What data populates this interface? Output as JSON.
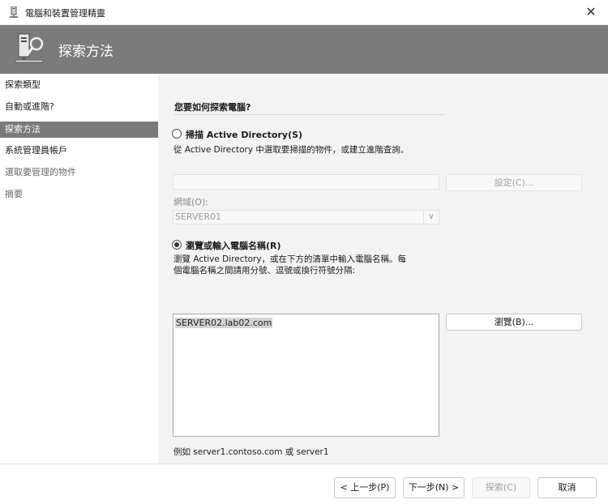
{
  "window": {
    "title": "電腦和裝置管理精靈",
    "close_glyph": "✕"
  },
  "banner": {
    "heading": "探索方法"
  },
  "sidebar": {
    "items": [
      {
        "label": "探索類型"
      },
      {
        "label": "自動或進階?"
      },
      {
        "label": "探索方法"
      },
      {
        "label": "系統管理員帳戶"
      },
      {
        "label": "選取要管理的物件"
      },
      {
        "label": "摘要"
      }
    ]
  },
  "main": {
    "question": "您要如何探索電腦?",
    "option_scan": {
      "label": "掃描 Active Directory(S)",
      "selected": false,
      "description": "從 Active Directory 中選取要掃描的物件，或建立進階查詢。"
    },
    "settings_button": "設定(C)...",
    "domain_label": "網域(O):",
    "domain_value": "SERVER01",
    "option_browse": {
      "label": "瀏覽或輸入電腦名稱(R)",
      "selected": true,
      "description_line1": "瀏覽 Active Directory，或在下方的清單中輸入電腦名稱。每",
      "description_line2": "個電腦名稱之間請用分號、逗號或換行符號分隔:"
    },
    "computer_names": "SERVER02.lab02.com",
    "browse_button": "瀏覽(B)...",
    "example": "例如 server1.contoso.com 或 server1"
  },
  "footer": {
    "back": "< 上一步(P)",
    "next": "下一步(N) >",
    "discover": "探索(C)",
    "cancel": "取消"
  }
}
